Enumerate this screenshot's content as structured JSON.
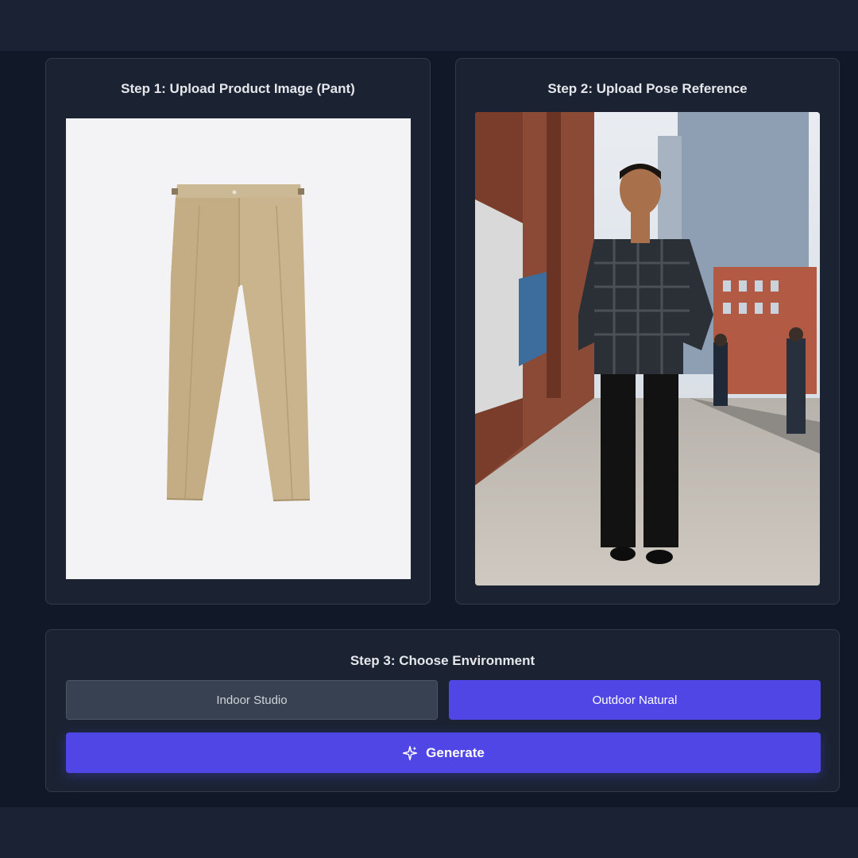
{
  "colors": {
    "accent": "#4f46e5",
    "card_bg": "#1b2333",
    "page_bg": "#111827",
    "inactive_button": "#374151"
  },
  "step1": {
    "title": "Step 1: Upload Product Image (Pant)",
    "image_subject": "khaki pants product photo"
  },
  "step2": {
    "title": "Step 2: Upload Pose Reference",
    "image_subject": "man in plaid shirt and black jeans on city sidewalk"
  },
  "step3": {
    "title": "Step 3: Choose Environment",
    "options": [
      {
        "label": "Indoor Studio",
        "selected": false
      },
      {
        "label": "Outdoor Natural",
        "selected": true
      }
    ],
    "generate_label": "Generate",
    "generate_icon": "sparkles-icon"
  }
}
